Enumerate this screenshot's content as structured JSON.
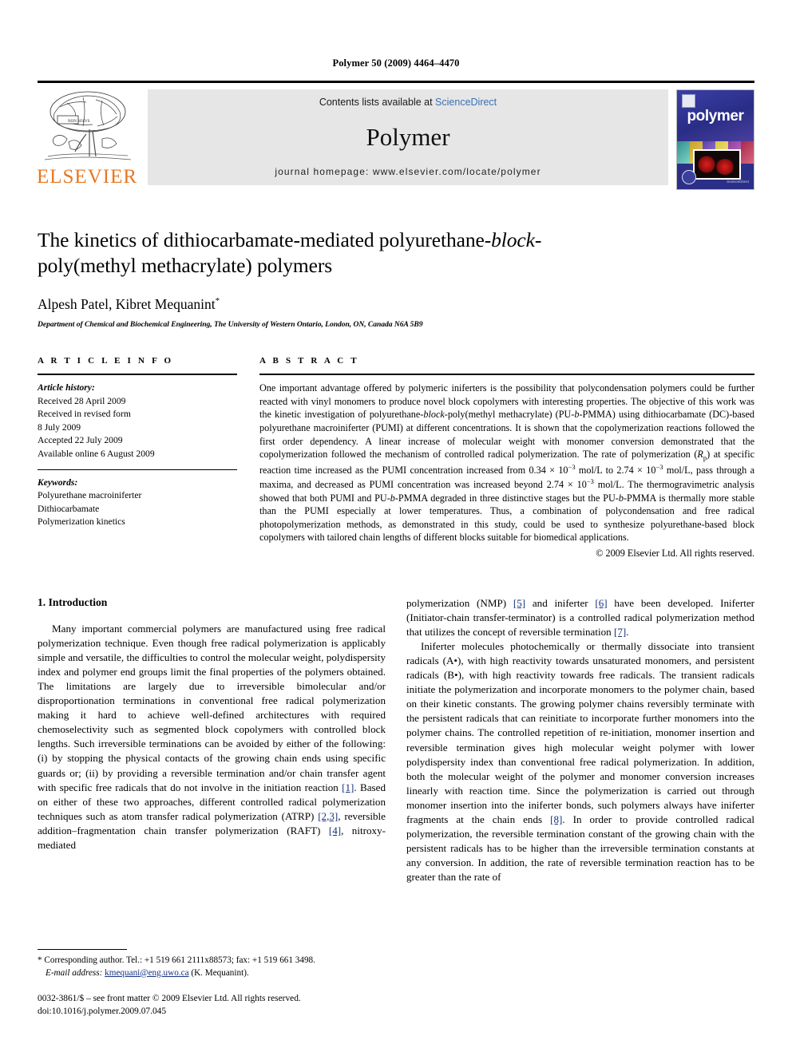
{
  "running_head": "Polymer 50 (2009) 4464–4470",
  "masthead": {
    "elsevier_wordmark": "ELSEVIER",
    "contents_prefix": "Contents lists available at ",
    "contents_link": "ScienceDirect",
    "journal_name": "Polymer",
    "homepage": "journal homepage: www.elsevier.com/locate/polymer",
    "cover_title": "polymer",
    "cover_footer": "ScienceDirect"
  },
  "title": {
    "line1_a": "The kinetics of dithiocarbamate-mediated polyurethane-",
    "line1_em": "block-",
    "line2": "poly(methyl methacrylate) polymers"
  },
  "authors": "Alpesh Patel, Kibret Mequanint",
  "author_marker": "*",
  "affiliation": "Department of Chemical and Biochemical Engineering, The University of Western Ontario, London, ON, Canada N6A 5B9",
  "article_info": {
    "heading": "A R T I C L E   I N F O",
    "history_label": "Article history:",
    "history": [
      "Received 28 April 2009",
      "Received in revised form",
      "8 July 2009",
      "Accepted 22 July 2009",
      "Available online 6 August 2009"
    ],
    "keywords_label": "Keywords:",
    "keywords": [
      "Polyurethane macroiniferter",
      "Dithiocarbamate",
      "Polymerization kinetics"
    ]
  },
  "abstract": {
    "heading": "A B S T R A C T",
    "p1": "One important advantage offered by polymeric iniferters is the possibility that polycondensation polymers could be further reacted with vinyl monomers to produce novel block copolymers with interesting properties. The objective of this work was the kinetic investigation of polyurethane-",
    "p1_em1": "block",
    "p1_b": "-poly(methyl methacrylate) (PU-",
    "p1_em2": "b",
    "p1_c": "-PMMA) using dithiocarbamate (DC)-based polyurethane macroiniferter (PUMI) at different concentrations. It is shown that the copolymerization reactions followed the first order dependency. A linear increase of molecular weight with monomer conversion demonstrated that the copolymerization followed the mechanism of controlled radical polymerization. The rate of polymerization (",
    "p1_rp": "R",
    "p1_rp_sub": "p",
    "p1_d": ") at specific reaction time increased as the PUMI concentration increased from 0.34 × 10",
    "p1_exp1": "−3",
    "p1_e": " mol/L to 2.74 × 10",
    "p1_exp2": "−3",
    "p1_f": " mol/L, pass through a maxima, and decreased as PUMI concentration was increased beyond 2.74 × 10",
    "p1_exp3": "−3",
    "p1_g": " mol/L. The thermogravimetric analysis showed that both PUMI and PU-",
    "p1_em3": "b",
    "p1_h": "-PMMA degraded in three distinctive stages but the PU-",
    "p1_em4": "b",
    "p1_i": "-PMMA is thermally more stable than the PUMI especially at lower temperatures. Thus, a combination of polycondensation and free radical photopolymerization methods, as demonstrated in this study, could be used to synthesize polyurethane-based block copolymers with tailored chain lengths of different blocks suitable for biomedical applications.",
    "copyright": "© 2009 Elsevier Ltd. All rights reserved."
  },
  "introduction": {
    "heading": "1. Introduction",
    "left_p1": "Many important commercial polymers are manufactured using free radical polymerization technique. Even though free radical polymerization is applicably simple and versatile, the difficulties to control the molecular weight, polydispersity index and polymer end groups limit the final properties of the polymers obtained. The limitations are largely due to irreversible bimolecular and/or disproportionation terminations in conventional free radical polymerization making it hard to achieve well-defined architectures with required chemoselectivity such as segmented block copolymers with controlled block lengths. Such irreversible terminations can be avoided by either of the following: (i) by stopping the physical contacts of the growing chain ends using specific guards or; (ii) by providing a reversible termination and/or chain transfer agent with specific free radicals that do not involve in the initiation reaction ",
    "ref1": "[1]",
    "left_p1b": ". Based on either of these two approaches, different controlled radical polymerization techniques such as atom transfer radical polymerization (ATRP) ",
    "ref23": "[2,3]",
    "left_p1c": ", reversible addition–fragmentation chain transfer polymerization (RAFT) ",
    "ref4": "[4]",
    "left_p1d": ", nitroxy-mediated",
    "right_p1a": "polymerization (NMP) ",
    "ref5": "[5]",
    "right_p1b": " and iniferter ",
    "ref6": "[6]",
    "right_p1c": " have been developed. Iniferter (Initiator-chain transfer-terminator) is a controlled radical polymerization method that utilizes the concept of reversible termination ",
    "ref7": "[7]",
    "right_p1d": ".",
    "right_p2a": "Iniferter molecules photochemically or thermally dissociate into transient radicals (A•), with high reactivity towards unsaturated monomers, and persistent radicals (B•), with high reactivity towards free radicals. The transient radicals initiate the polymerization and incorporate monomers to the polymer chain, based on their kinetic constants. The growing polymer chains reversibly terminate with the persistent radicals that can reinitiate to incorporate further monomers into the polymer chains. The controlled repetition of re-initiation, monomer insertion and reversible termination gives high molecular weight polymer with lower polydispersity index than conventional free radical polymerization. In addition, both the molecular weight of the polymer and monomer conversion increases linearly with reaction time. Since the polymerization is carried out through monomer insertion into the iniferter bonds, such polymers always have iniferter fragments at the chain ends ",
    "ref8": "[8]",
    "right_p2b": ". In order to provide controlled radical polymerization, the reversible termination constant of the growing chain with the persistent radicals has to be higher than the irreversible termination constants at any conversion. In addition, the rate of reversible termination reaction has to be greater than the rate of"
  },
  "footnote": {
    "marker": "*",
    "text": " Corresponding author. Tel.: +1 519 661 2111x88573; fax: +1 519 661 3498.",
    "email_label": "E-mail address:",
    "email": "kmequani@eng.uwo.ca",
    "email_suffix": " (K. Mequanint)."
  },
  "footer": {
    "line1": "0032-3861/$ – see front matter © 2009 Elsevier Ltd. All rights reserved.",
    "line2": "doi:10.1016/j.polymer.2009.07.045"
  },
  "colors": {
    "elsevier_orange": "#E87722",
    "link_blue": "#3b6fb6",
    "ref_blue": "#15317E",
    "panel_gray": "#e6e6e6",
    "cover_blue": "#2b2f88"
  }
}
